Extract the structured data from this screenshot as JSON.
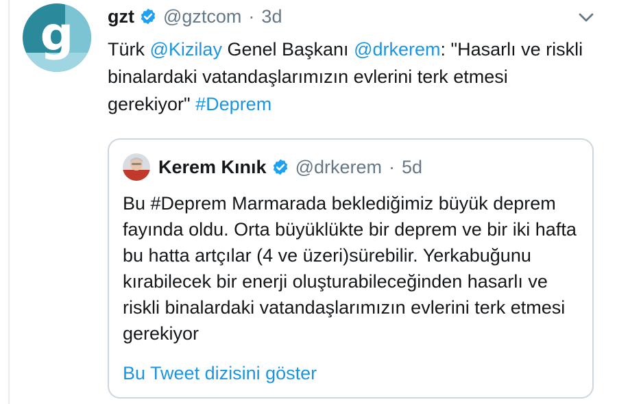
{
  "tweet": {
    "author_name": "gzt",
    "handle": "@gztcom",
    "separator": "·",
    "time": "3d",
    "avatar_letter": "g",
    "text_parts": {
      "t1": "Türk ",
      "mention1": "@Kizilay",
      "t2": " Genel Başkanı ",
      "mention2": "@drkerem",
      "t3": ": \"Hasarlı ve riskli binalardaki vatandaşlarımızın evlerini terk etmesi gerekiyor\" ",
      "hashtag": "#Deprem"
    }
  },
  "quote": {
    "author_name": "Kerem Kınık",
    "handle": "@drkerem",
    "separator": "·",
    "time": "5d",
    "body": "Bu #Deprem Marmarada beklediğimiz büyük deprem fayında oldu. Orta büyüklükte bir deprem ve bir iki hafta bu hatta artçılar (4 ve üzeri)sürebilir. Yerkabuğunu kırabilecek bir enerji oluşturabileceğinden hasarlı ve riskli binalardaki vatandaşlarımızın evlerini terk etmesi gerekiyor",
    "show_thread": "Bu Tweet dizisini göster"
  },
  "icons": {
    "verified": "verified-badge-icon",
    "menu": "chevron-down-icon"
  },
  "colors": {
    "link": "#1b95e0",
    "text": "#14171a",
    "muted": "#657786",
    "border": "#ccd6dd",
    "verified": "#1da1f2",
    "gzt_teal": "#2a8a9c",
    "gzt_light": "#7cc4d4"
  }
}
